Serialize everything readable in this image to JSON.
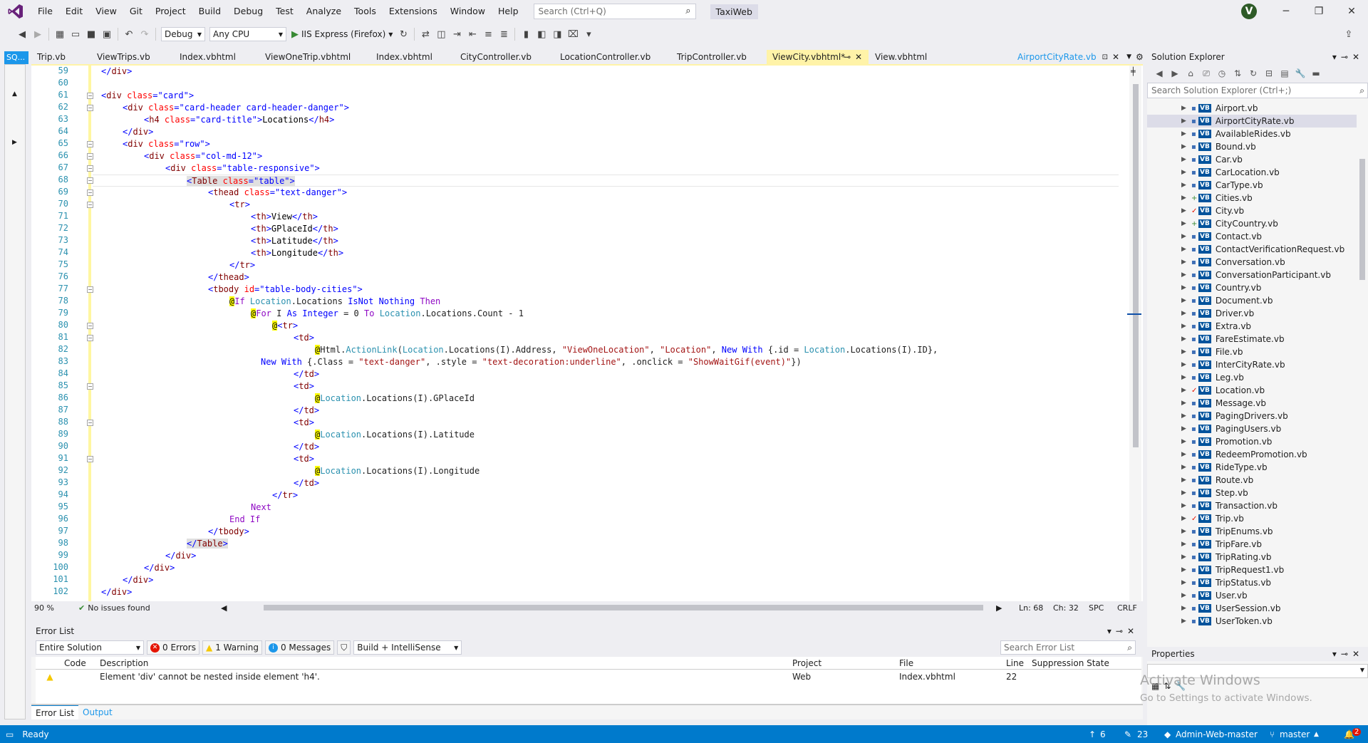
{
  "menu": [
    "File",
    "Edit",
    "View",
    "Git",
    "Project",
    "Build",
    "Debug",
    "Test",
    "Analyze",
    "Tools",
    "Extensions",
    "Window",
    "Help"
  ],
  "search": {
    "placeholder": "Search (Ctrl+Q)"
  },
  "app_name": "TaxiWeb",
  "user_initial": "V",
  "toolbar": {
    "config": "Debug",
    "platform": "Any CPU",
    "run_target": "IIS Express (Firefox)"
  },
  "side_tab": "SQ...",
  "tabs": [
    {
      "label": "Trip.vb"
    },
    {
      "label": "ViewTrips.vb"
    },
    {
      "label": "Index.vbhtml"
    },
    {
      "label": "ViewOneTrip.vbhtml"
    },
    {
      "label": "Index.vbhtml"
    },
    {
      "label": "CityController.vb"
    },
    {
      "label": "LocationController.vb"
    },
    {
      "label": "TripController.vb"
    },
    {
      "label": "ViewCity.vbhtml*"
    },
    {
      "label": "View.vbhtml"
    }
  ],
  "preview_tab": "AirportCityRate.vb",
  "code": {
    "line_numbers": [
      "59",
      "60",
      "61",
      "62",
      "63",
      "64",
      "65",
      "66",
      "67",
      "68",
      "69",
      "70",
      "71",
      "72",
      "73",
      "74",
      "75",
      "76",
      "77",
      "78",
      "79",
      "80",
      "81",
      "82",
      "83",
      "84",
      "85",
      "86",
      "87",
      "88",
      "89",
      "90",
      "91",
      "92",
      "93",
      "94",
      "95",
      "96",
      "97",
      "98",
      "99",
      "100",
      "101",
      "102"
    ]
  },
  "editor_status": {
    "zoom": "90 %",
    "issues": "No issues found",
    "line": "Ln: 68",
    "col": "Ch: 32",
    "mode": "SPC",
    "eol": "CRLF"
  },
  "solution_explorer": {
    "title": "Solution Explorer",
    "search_placeholder": "Search Solution Explorer (Ctrl+;)",
    "files": [
      "Airport.vb",
      "AirportCityRate.vb",
      "AvailableRides.vb",
      "Bound.vb",
      "Car.vb",
      "CarLocation.vb",
      "CarType.vb",
      "Cities.vb",
      "City.vb",
      "CityCountry.vb",
      "Contact.vb",
      "ContactVerificationRequest.vb",
      "Conversation.vb",
      "ConversationParticipant.vb",
      "Country.vb",
      "Document.vb",
      "Driver.vb",
      "Extra.vb",
      "FareEstimate.vb",
      "File.vb",
      "InterCityRate.vb",
      "Leg.vb",
      "Location.vb",
      "Message.vb",
      "PagingDrivers.vb",
      "PagingUsers.vb",
      "Promotion.vb",
      "RedeemPromotion.vb",
      "RideType.vb",
      "Route.vb",
      "Step.vb",
      "Transaction.vb",
      "Trip.vb",
      "TripEnums.vb",
      "TripFare.vb",
      "TripRating.vb",
      "TripRequest1.vb",
      "TripStatus.vb",
      "User.vb",
      "UserSession.vb",
      "UserToken.vb"
    ],
    "vb_label": "VB"
  },
  "properties": {
    "title": "Properties"
  },
  "error_list": {
    "title": "Error List",
    "scope": "Entire Solution",
    "errors": "0 Errors",
    "warnings": "1 Warning",
    "messages": "0 Messages",
    "build_filter": "Build + IntelliSense",
    "search_placeholder": "Search Error List",
    "columns": [
      "Code",
      "Description",
      "Project",
      "File",
      "Line",
      "Suppression State"
    ],
    "rows": [
      {
        "code": "",
        "description": "Element 'div' cannot be nested inside element 'h4'.",
        "project": "Web",
        "file": "Index.vbhtml",
        "line": "22",
        "suppression": ""
      }
    ]
  },
  "bottom_tabs": [
    "Error List",
    "Output"
  ],
  "watermark": {
    "line1": "Activate Windows",
    "line2": "Go to Settings to activate Windows."
  },
  "statusbar": {
    "ready": "Ready",
    "up": "6",
    "pending": "23",
    "repo": "Admin-Web-master",
    "branch": "master",
    "notifications": "2"
  },
  "colors": {
    "accent": "#007acc",
    "active_tab": "#fff3a8",
    "vs_purple": "#68217a"
  }
}
